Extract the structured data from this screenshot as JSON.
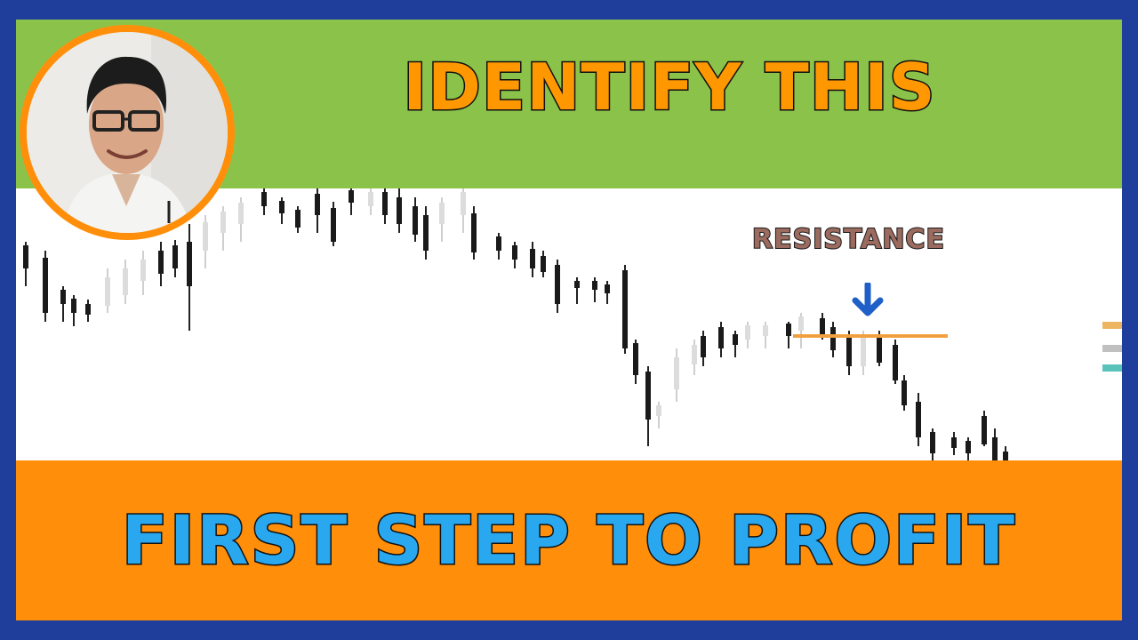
{
  "headline": "IDENTIFY THIS",
  "subline": "FIRST STEP TO PROFIT",
  "chart": {
    "annotation": "RESISTANCE"
  },
  "colors": {
    "outer_border": "#1f3e9c",
    "top_band": "#8bc34a",
    "bottom_band": "#ff8f0a",
    "headline_fill": "#ff9800",
    "subline_fill": "#29a8f0",
    "arrow": "#1f5fc8",
    "resistance_line": "#f0a040"
  },
  "icons": {
    "arrow": "arrow-down-icon"
  }
}
